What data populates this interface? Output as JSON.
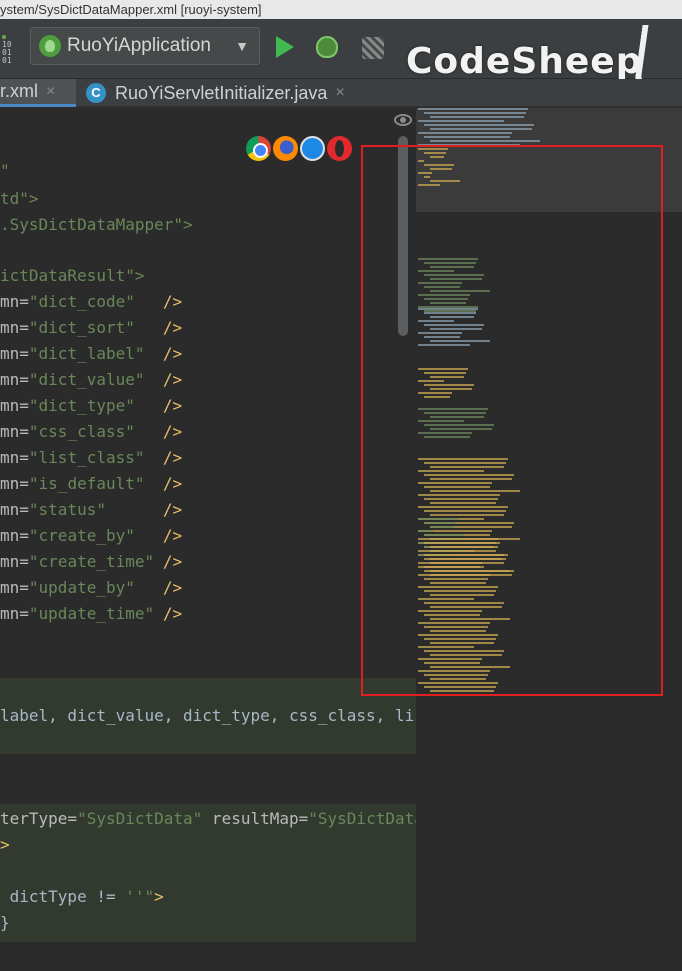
{
  "window": {
    "title": "ystem/SysDictDataMapper.xml [ruoyi-system]"
  },
  "toolbar": {
    "binary_icon_text": "10\n01\n01",
    "run_config": "RuoYiApplication",
    "watermark": "CodeSheep"
  },
  "tabs": [
    {
      "label": "r.xml",
      "close": "×",
      "active": true
    },
    {
      "label": "RuoYiServletInitializer.java",
      "close": "×",
      "icon_letter": "C",
      "active": false
    }
  ],
  "editor": {
    "lines": [
      {
        "a": "\"",
        "b": "",
        "c": ""
      },
      {
        "a": "td\">",
        "b": "",
        "c": ""
      },
      {
        "a": ".SysDictDataMapper\">",
        "b": "",
        "c": ""
      },
      {
        "a": "ictDataResult\">",
        "b": "",
        "c": ""
      }
    ],
    "result_rows": [
      {
        "prefix": "mn=",
        "value": "\"dict_code\"",
        "end": "/>"
      },
      {
        "prefix": "mn=",
        "value": "\"dict_sort\"",
        "end": "/>"
      },
      {
        "prefix": "mn=",
        "value": "\"dict_label\"",
        "end": "/>"
      },
      {
        "prefix": "mn=",
        "value": "\"dict_value\"",
        "end": "/>"
      },
      {
        "prefix": "mn=",
        "value": "\"dict_type\"",
        "end": "/>"
      },
      {
        "prefix": "mn=",
        "value": "\"css_class\"",
        "end": "/>"
      },
      {
        "prefix": "mn=",
        "value": "\"list_class\"",
        "end": "/>"
      },
      {
        "prefix": "mn=",
        "value": "\"is_default\"",
        "end": "/>"
      },
      {
        "prefix": "mn=",
        "value": "\"status\"",
        "end": "/>"
      },
      {
        "prefix": "mn=",
        "value": "\"create_by\"",
        "end": "/>"
      },
      {
        "prefix": "mn=",
        "value": "\"create_time\"",
        "end": "/>"
      },
      {
        "prefix": "mn=",
        "value": "\"update_by\"",
        "end": "/>"
      },
      {
        "prefix": "mn=",
        "value": "\"update_time\"",
        "end": "/>"
      }
    ],
    "sql_line": "label, dict_value, dict_type, css_class, list_",
    "select_line": {
      "a": "terType=",
      "b": "\"SysDictData\"",
      "c": " resultMap=",
      "d": "\"SysDictDataRe"
    },
    "gt_line": ">",
    "if_line": {
      "a": " dictType != ",
      "b": "''\"",
      "c": ">"
    },
    "close_line": "}"
  },
  "colors": {
    "background": "#2b2b2b",
    "attribute": "#bababa",
    "string": "#6a8759",
    "tag": "#e8bf6a",
    "highlight": "#323a30",
    "focus_box": "#e02020"
  }
}
